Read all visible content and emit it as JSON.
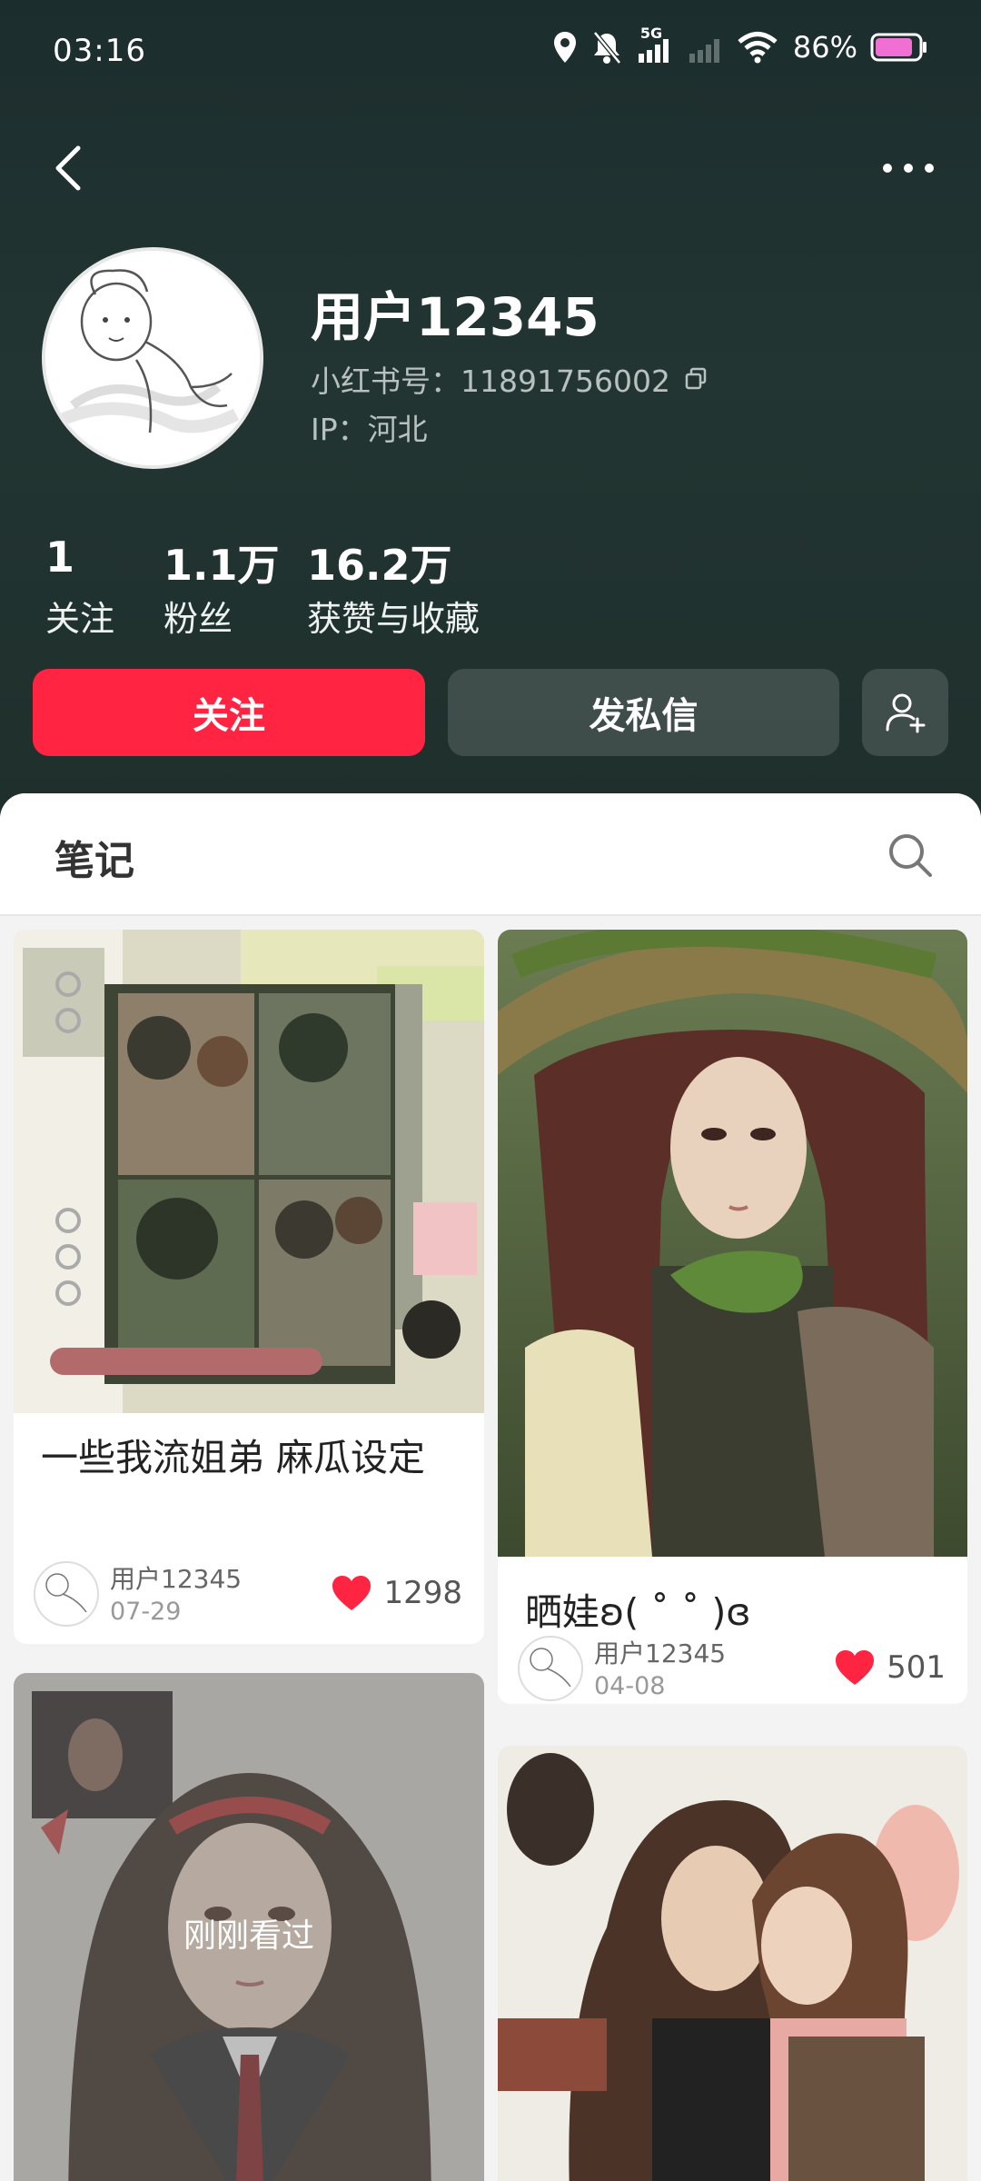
{
  "status_bar": {
    "time": "03:16",
    "network": "5G",
    "battery_percent": "86%",
    "battery_level": 0.86,
    "battery_color": "#f06fd2"
  },
  "nav": {
    "back_icon": "chevron-left-icon",
    "more_icon": "more-horizontal-icon"
  },
  "profile": {
    "username": "用户12345",
    "redbook_id": "小红书号：11891756002",
    "ip": "IP：河北"
  },
  "stats": [
    {
      "value": "1",
      "label": "关注"
    },
    {
      "value": "1.1万",
      "label": "粉丝"
    },
    {
      "value": "16.2万",
      "label": "获赞与收藏"
    }
  ],
  "actions": {
    "follow_label": "关注",
    "message_label": "发私信",
    "follow_color": "#ff2442"
  },
  "tabs": {
    "notes_label": "笔记"
  },
  "notes": [
    {
      "title": "一些我流姐弟 麻瓜设定",
      "author": "用户12345",
      "date": "07-29",
      "likes": "1298"
    },
    {
      "title": "晒娃ʚ( ˚ ˚ )ɞ",
      "author": "用户12345",
      "date": "04-08",
      "likes": "501"
    },
    {
      "title": "",
      "viewed_label": "刚刚看过"
    },
    {
      "title": ""
    }
  ]
}
